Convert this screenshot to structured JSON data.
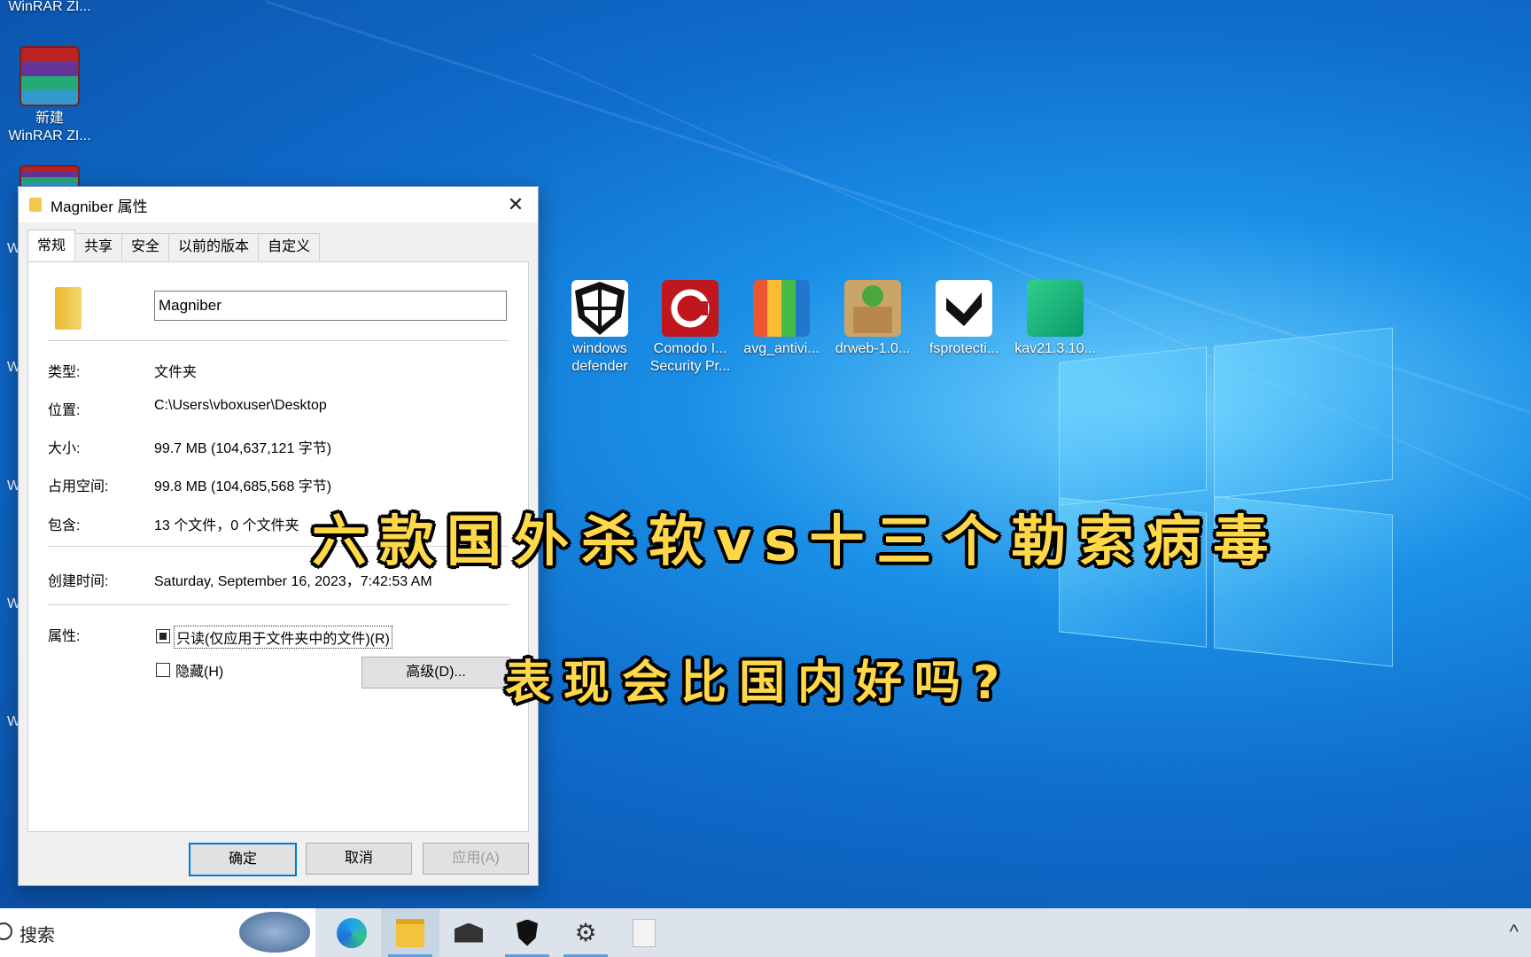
{
  "desktop": {
    "icons_left": [
      {
        "label": "WinRAR ZI...",
        "icon": "winrar-icon"
      },
      {
        "label": "新建\nWinRAR ZI...",
        "icon": "winrar-icon"
      },
      {
        "label": "",
        "icon": "winrar-icon"
      }
    ],
    "icons_row": [
      {
        "label": "windows\ndefender",
        "icon": "shield-icon"
      },
      {
        "label": "Comodo I...\nSecurity Pr...",
        "icon": "comodo-icon"
      },
      {
        "label": "avg_antivi...",
        "icon": "avg-icon"
      },
      {
        "label": "drweb-1.0...",
        "icon": "drweb-icon"
      },
      {
        "label": "fsprotecti...",
        "icon": "fsecure-icon"
      },
      {
        "label": "kav21.3.10...",
        "icon": "kaspersky-icon"
      }
    ],
    "side_letters": [
      "W",
      "W",
      "W",
      "W",
      "W",
      "W"
    ]
  },
  "dialog": {
    "title": "Magniber 属性",
    "tabs": [
      "常规",
      "共享",
      "安全",
      "以前的版本",
      "自定义"
    ],
    "name_value": "Magniber",
    "rows": [
      {
        "label": "类型:",
        "value": "文件夹"
      },
      {
        "label": "位置:",
        "value": "C:\\Users\\vboxuser\\Desktop"
      },
      {
        "label": "大小:",
        "value": "99.7 MB (104,637,121 字节)"
      },
      {
        "label": "占用空间:",
        "value": "99.8 MB (104,685,568 字节)"
      },
      {
        "label": "包含:",
        "value": "13 个文件，0 个文件夹"
      },
      {
        "label": "创建时间:",
        "value": "Saturday, September 16, 2023，7:42:53 AM"
      }
    ],
    "attributes_label": "属性:",
    "readonly_label": "只读(仅应用于文件夹中的文件)(R)",
    "hidden_label": "隐藏(H)",
    "advanced_label": "高级(D)...",
    "ok_label": "确定",
    "cancel_label": "取消",
    "apply_label": "应用(A)"
  },
  "caption": {
    "line1": "六款国外杀软vs十三个勒索病毒",
    "line2": "表现会比国内好吗?"
  },
  "taskbar": {
    "search_text": "搜索",
    "tray_chevron": "^"
  },
  "colors": {
    "accent": "#0078d7",
    "caption": "#ffd84a"
  }
}
